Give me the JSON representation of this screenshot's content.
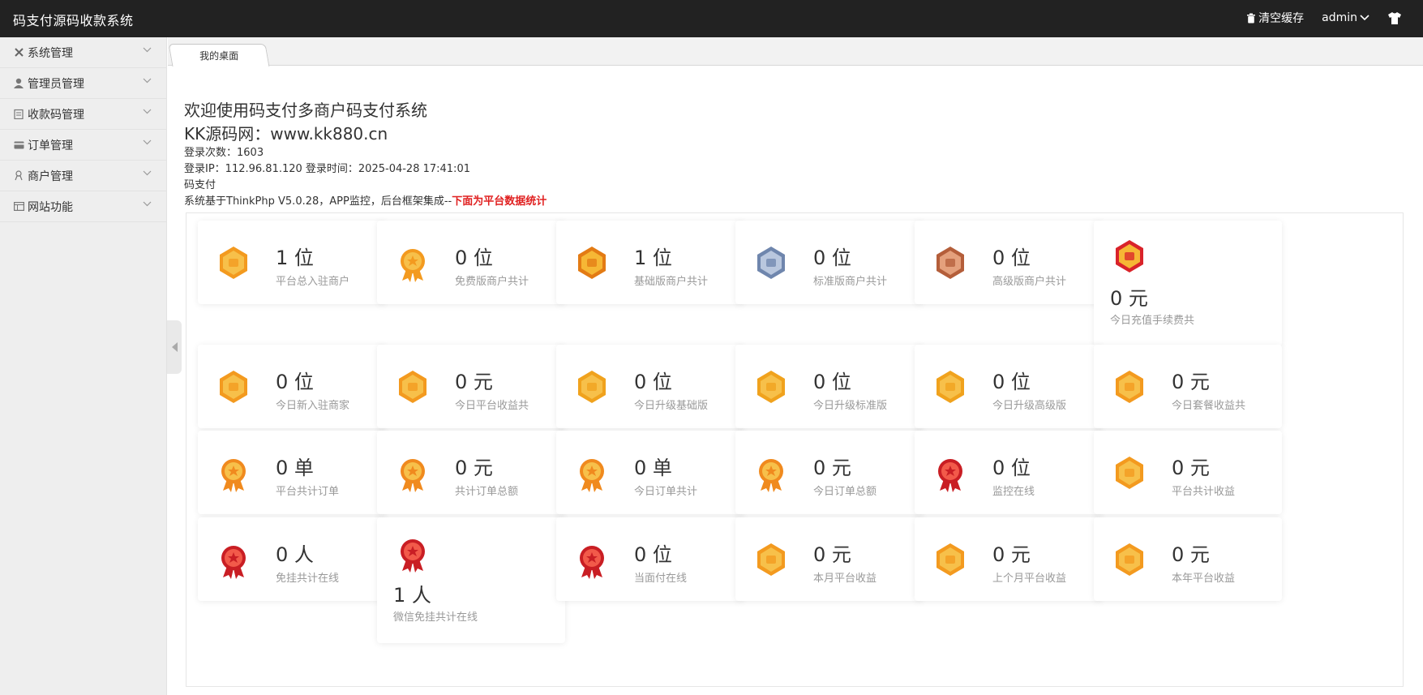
{
  "header": {
    "title": "码支付源码收款系统",
    "clear_cache": "清空缓存",
    "user": "admin"
  },
  "sidebar": {
    "items": [
      {
        "label": "系统管理",
        "icon": "tools-icon"
      },
      {
        "label": "管理员管理",
        "icon": "user-icon"
      },
      {
        "label": "收款码管理",
        "icon": "clipboard-icon"
      },
      {
        "label": "订单管理",
        "icon": "card-icon"
      },
      {
        "label": "商户管理",
        "icon": "merchant-icon"
      },
      {
        "label": "网站功能",
        "icon": "window-icon"
      }
    ]
  },
  "tabs": [
    {
      "label": "我的桌面"
    }
  ],
  "welcome": {
    "line1": "欢迎使用码支付多商户码支付系统",
    "line2": "KK源码网：www.kk880.cn",
    "login_count": "登录次数：1603",
    "login_info": "登录IP：112.96.81.120 登录时间：2025-04-28 17:41:01",
    "brand": "码支付",
    "desc": "系统基于ThinkPhp V5.0.28，APP监控，后台框架集成--",
    "desc_red": "下面为平台数据统计"
  },
  "colors": {
    "gold": "#f5b43a",
    "orange": "#f08a1e",
    "red": "#d9232a",
    "silver": "#8fa3c2",
    "bronze": "#c8774e"
  },
  "stats": [
    {
      "value": "1 位",
      "label": "平台总入驻商户",
      "icon": "trophy-medal-icon"
    },
    {
      "value": "0 位",
      "label": "免费版商户共计",
      "icon": "ribbon-medal-icon"
    },
    {
      "value": "1 位",
      "label": "基础版商户共计",
      "icon": "gold-badge-icon"
    },
    {
      "value": "0 位",
      "label": "标准版商户共计",
      "icon": "silver-badge-icon"
    },
    {
      "value": "0 位",
      "label": "高级版商户共计",
      "icon": "bronze-badge-icon"
    },
    {
      "value": "0 元",
      "label": "今日充值手续费共",
      "icon": "shield-badge-icon"
    },
    {
      "value": "0 位",
      "label": "今日新入驻商家",
      "icon": "trophy-medal-icon"
    },
    {
      "value": "0 元",
      "label": "今日平台收益共",
      "icon": "crown-medal-icon"
    },
    {
      "value": "0 位",
      "label": "今日升级基础版",
      "icon": "vip-medal-icon"
    },
    {
      "value": "0 位",
      "label": "今日升级标准版",
      "icon": "vip-medal-icon"
    },
    {
      "value": "0 位",
      "label": "今日升级高级版",
      "icon": "vip-medal-icon"
    },
    {
      "value": "0 元",
      "label": "今日套餐收益共",
      "icon": "crown-medal-icon"
    },
    {
      "value": "0 单",
      "label": "平台共计订单",
      "icon": "rosette-medal-icon"
    },
    {
      "value": "0 元",
      "label": "共计订单总额",
      "icon": "rosette-medal-icon"
    },
    {
      "value": "0 单",
      "label": "今日订单共计",
      "icon": "rosette-medal-icon"
    },
    {
      "value": "0 元",
      "label": "今日订单总额",
      "icon": "rosette-medal-icon"
    },
    {
      "value": "0 位",
      "label": "监控在线",
      "icon": "red-rosette-icon"
    },
    {
      "value": "0 元",
      "label": "平台共计收益",
      "icon": "crown-medal-icon"
    },
    {
      "value": "0 人",
      "label": "免挂共计在线",
      "icon": "red-rosette-icon"
    },
    {
      "value": "1 人",
      "label": "微信免挂共计在线",
      "icon": "red-rosette-icon"
    },
    {
      "value": "0 位",
      "label": "当面付在线",
      "icon": "red-rosette-icon"
    },
    {
      "value": "0 元",
      "label": "本月平台收益",
      "icon": "crown-medal-icon"
    },
    {
      "value": "0 元",
      "label": "上个月平台收益",
      "icon": "crown-medal-icon"
    },
    {
      "value": "0 元",
      "label": "本年平台收益",
      "icon": "crown-medal-icon"
    }
  ]
}
